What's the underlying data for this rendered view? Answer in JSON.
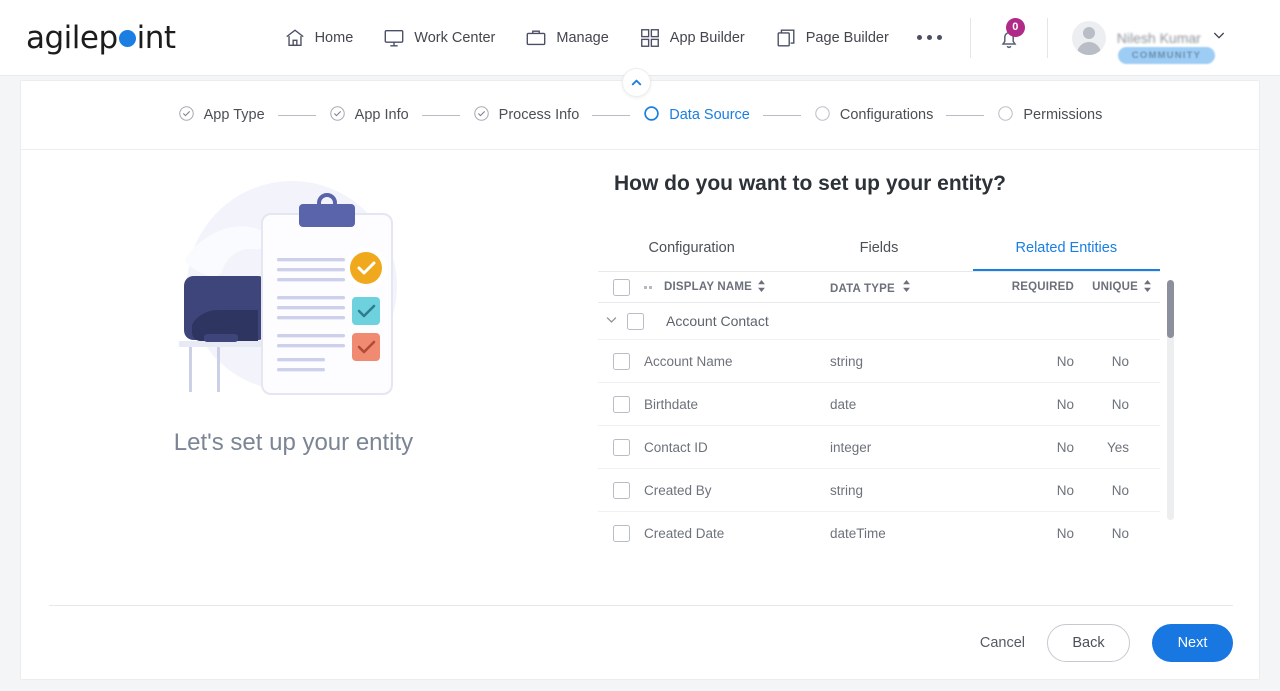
{
  "brand": {
    "name_part1": "agilep",
    "name_part2": "int",
    "accent": "#1a7ee3"
  },
  "topnav": {
    "items": [
      {
        "label": "Home",
        "icon": "home-icon"
      },
      {
        "label": "Work Center",
        "icon": "monitor-icon"
      },
      {
        "label": "Manage",
        "icon": "briefcase-icon"
      },
      {
        "label": "App Builder",
        "icon": "grid-icon"
      },
      {
        "label": "Page Builder",
        "icon": "pages-icon"
      }
    ],
    "more_label": "•••",
    "notification_count": "0",
    "user_name": "Nilesh Kumar",
    "user_badge": "COMMUNITY"
  },
  "stepper": {
    "steps": [
      {
        "label": "App Type",
        "state": "done"
      },
      {
        "label": "App Info",
        "state": "done"
      },
      {
        "label": "Process Info",
        "state": "done"
      },
      {
        "label": "Data Source",
        "state": "active"
      },
      {
        "label": "Configurations",
        "state": "pending"
      },
      {
        "label": "Permissions",
        "state": "pending"
      }
    ]
  },
  "left": {
    "caption": "Let's set up your entity"
  },
  "main": {
    "title": "How do you want to set up your entity?",
    "tabs": [
      {
        "label": "Configuration",
        "active": false
      },
      {
        "label": "Fields",
        "active": false
      },
      {
        "label": "Related Entities",
        "active": true
      }
    ],
    "table": {
      "columns": [
        "DISPLAY NAME",
        "DATA TYPE",
        "REQUIRED",
        "UNIQUE"
      ],
      "group": {
        "label": "Account Contact",
        "expanded": true
      },
      "rows": [
        {
          "name": "Account Name",
          "type": "string",
          "required": "No",
          "unique": "No"
        },
        {
          "name": "Birthdate",
          "type": "date",
          "required": "No",
          "unique": "No"
        },
        {
          "name": "Contact ID",
          "type": "integer",
          "required": "No",
          "unique": "Yes"
        },
        {
          "name": "Created By",
          "type": "string",
          "required": "No",
          "unique": "No"
        },
        {
          "name": "Created Date",
          "type": "dateTime",
          "required": "No",
          "unique": "No"
        }
      ]
    }
  },
  "footer": {
    "cancel": "Cancel",
    "back": "Back",
    "next": "Next"
  }
}
